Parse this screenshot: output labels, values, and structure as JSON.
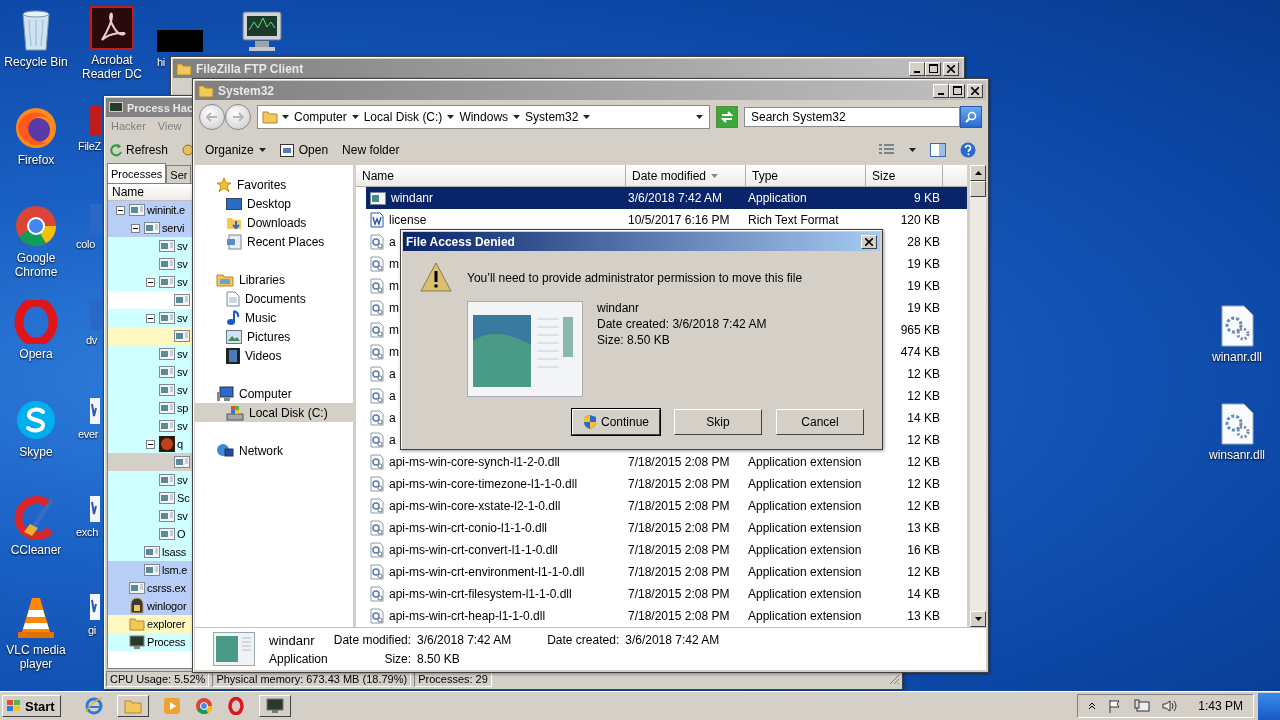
{
  "desktop_icons": [
    {
      "kind": "recycle",
      "label": "Recycle Bin"
    },
    {
      "kind": "pdf",
      "label": "Acrobat Reader DC"
    },
    {
      "kind": "black",
      "label": "hi"
    },
    {
      "kind": "monitor"
    },
    {
      "kind": "firefox",
      "label": "Firefox"
    },
    {
      "kind": "filezilla",
      "label": "FileZ"
    },
    {
      "kind": "chrome",
      "label": "Google Chrome"
    },
    {
      "kind": "doc",
      "label": "colo"
    },
    {
      "kind": "opera",
      "label": "Opera"
    },
    {
      "kind": "doc",
      "label": "dv"
    },
    {
      "kind": "skype",
      "label": "Skype"
    },
    {
      "kind": "word",
      "label": "ever"
    },
    {
      "kind": "ccleaner",
      "label": "CCleaner"
    },
    {
      "kind": "word",
      "label": "exch"
    },
    {
      "kind": "vlc",
      "label": "VLC media player"
    },
    {
      "kind": "word",
      "label": "gi"
    },
    {
      "kind": "dll",
      "label": "winanr.dll"
    },
    {
      "kind": "dll",
      "label": "winsanr.dll"
    }
  ],
  "filezilla": {
    "title": "FileZilla FTP Client"
  },
  "process_hacker": {
    "title": "Process Hac",
    "menu": [
      "Hacker",
      "View"
    ],
    "toolbar": [
      "Refresh"
    ],
    "tabs": [
      {
        "label": "Processes",
        "selected": true
      },
      {
        "label": "Ser",
        "selected": false
      }
    ],
    "column": "Name",
    "processes": [
      {
        "name": "wininit.e",
        "kind": "exe",
        "color": "#b8cef6",
        "expanded": true,
        "children": [
          {
            "name": "servi",
            "kind": "exe",
            "color": "#b8cef6",
            "expanded": true,
            "children": [
              {
                "name": "sv",
                "kind": "exe",
                "color": "#d0ffff"
              },
              {
                "name": "sv",
                "kind": "exe",
                "color": "#d0ffff"
              },
              {
                "name": "sv",
                "kind": "exe",
                "color": "#d0ffff",
                "expanded": true,
                "children": [
                  {
                    "kind": "exe",
                    "color": "#ffffff"
                  }
                ]
              },
              {
                "name": "sv",
                "kind": "exe",
                "color": "#d0ffff",
                "expanded": true,
                "children": [
                  {
                    "kind": "exe",
                    "color": "#fff8c0"
                  }
                ]
              },
              {
                "name": "sv",
                "kind": "exe",
                "color": "#d0ffff"
              },
              {
                "name": "sv",
                "kind": "exe",
                "color": "#d0ffff"
              },
              {
                "name": "sv",
                "kind": "exe",
                "color": "#d0ffff"
              },
              {
                "name": "sp",
                "kind": "exe",
                "color": "#d0ffff"
              },
              {
                "name": "sv",
                "kind": "exe",
                "color": "#d0ffff"
              },
              {
                "name": "q",
                "kind": "game",
                "color": "#d0ffff",
                "expanded": true,
                "children": [
                  {
                    "kind": "exe",
                    "color": "#d4d0c8"
                  }
                ]
              },
              {
                "name": "sv",
                "kind": "exe",
                "color": "#d0ffff"
              },
              {
                "name": "Sc",
                "kind": "exe",
                "color": "#d0ffff"
              },
              {
                "name": "sv",
                "kind": "exe",
                "color": "#d0ffff"
              },
              {
                "name": "O",
                "kind": "exe",
                "color": "#d0ffff"
              }
            ]
          },
          {
            "name": "lsass",
            "kind": "exe",
            "color": "#d0ffff"
          },
          {
            "name": "lsm.e",
            "kind": "exe",
            "color": "#b8cef6"
          }
        ]
      },
      {
        "name": "csrss.ex",
        "kind": "exe",
        "color": "#b8cef6"
      },
      {
        "name": "winlogor",
        "kind": "winlogon",
        "color": "#b8cef6"
      },
      {
        "name": "explorer",
        "kind": "folder",
        "color": "#fff8c0"
      },
      {
        "name": "Process",
        "kind": "hacker",
        "color": "#d0ffff"
      }
    ],
    "status": [
      "CPU Usage: 5.52%",
      "Physical memory: 673.43 MB (18.79%)",
      "Processes: 29"
    ]
  },
  "explorer": {
    "title": "System32",
    "breadcrumb": [
      "Computer",
      "Local Disk (C:)",
      "Windows",
      "System32"
    ],
    "search": {
      "placeholder": "Search System32"
    },
    "toolbar": [
      "Organize",
      "Open",
      "New folder"
    ],
    "nav": [
      {
        "label": "Favorites",
        "kind": "favorites",
        "selected": false,
        "children": [
          {
            "label": "Desktop",
            "kind": "desktop",
            "selected": false
          },
          {
            "label": "Downloads",
            "kind": "downloads",
            "selected": false
          },
          {
            "label": "Recent Places",
            "kind": "recent",
            "selected": false
          }
        ]
      },
      {
        "label": "Libraries",
        "kind": "libraries",
        "selected": false,
        "children": [
          {
            "label": "Documents",
            "kind": "documents",
            "selected": false
          },
          {
            "label": "Music",
            "kind": "music",
            "selected": false
          },
          {
            "label": "Pictures",
            "kind": "pictures",
            "selected": false
          },
          {
            "label": "Videos",
            "kind": "videos",
            "selected": false
          }
        ]
      },
      {
        "label": "Computer",
        "kind": "computer",
        "selected": false,
        "children": [
          {
            "label": "Local Disk (C:)",
            "kind": "disk",
            "selected": true
          }
        ]
      },
      {
        "label": "Network",
        "kind": "network",
        "selected": false
      }
    ],
    "columns": [
      {
        "label": "Name",
        "sorted": false
      },
      {
        "label": "Date modified",
        "sorted": true
      },
      {
        "label": "Type",
        "sorted": false
      },
      {
        "label": "Size",
        "sorted": false
      }
    ],
    "files": [
      {
        "name": "windanr",
        "date": "3/6/2018 7:42 AM",
        "type": "Application",
        "size": "9 KB",
        "kind": "app",
        "selected": true
      },
      {
        "name": "license",
        "date": "10/5/2017 6:16 PM",
        "type": "Rich Text Format",
        "size": "120 KB",
        "kind": "rtf",
        "selected": false
      },
      {
        "name": "a",
        "size": "28 KB",
        "kind": "dll",
        "selected": false
      },
      {
        "name": "m",
        "size": "19 KB",
        "kind": "dll",
        "selected": false
      },
      {
        "name": "m",
        "size": "19 KB",
        "kind": "dll",
        "selected": false
      },
      {
        "name": "m",
        "size": "19 KB",
        "kind": "dll",
        "selected": false
      },
      {
        "name": "m",
        "size": "965 KB",
        "kind": "dll",
        "selected": false
      },
      {
        "name": "m",
        "size": "474 KB",
        "kind": "dll",
        "selected": false
      },
      {
        "name": "a",
        "size": "12 KB",
        "kind": "dll",
        "selected": false
      },
      {
        "name": "a",
        "size": "12 KB",
        "kind": "dll",
        "selected": false
      },
      {
        "name": "a",
        "size": "14 KB",
        "kind": "dll",
        "selected": false
      },
      {
        "name": "a",
        "size": "12 KB",
        "kind": "dll",
        "selected": false
      },
      {
        "name": "api-ms-win-core-synch-l1-2-0.dll",
        "date": "7/18/2015 2:08 PM",
        "type": "Application extension",
        "size": "12 KB",
        "kind": "dll",
        "selected": false
      },
      {
        "name": "api-ms-win-core-timezone-l1-1-0.dll",
        "date": "7/18/2015 2:08 PM",
        "type": "Application extension",
        "size": "12 KB",
        "kind": "dll",
        "selected": false
      },
      {
        "name": "api-ms-win-core-xstate-l2-1-0.dll",
        "date": "7/18/2015 2:08 PM",
        "type": "Application extension",
        "size": "12 KB",
        "kind": "dll",
        "selected": false
      },
      {
        "name": "api-ms-win-crt-conio-l1-1-0.dll",
        "date": "7/18/2015 2:08 PM",
        "type": "Application extension",
        "size": "13 KB",
        "kind": "dll",
        "selected": false
      },
      {
        "name": "api-ms-win-crt-convert-l1-1-0.dll",
        "date": "7/18/2015 2:08 PM",
        "type": "Application extension",
        "size": "16 KB",
        "kind": "dll",
        "selected": false
      },
      {
        "name": "api-ms-win-crt-environment-l1-1-0.dll",
        "date": "7/18/2015 2:08 PM",
        "type": "Application extension",
        "size": "12 KB",
        "kind": "dll",
        "selected": false
      },
      {
        "name": "api-ms-win-crt-filesystem-l1-1-0.dll",
        "date": "7/18/2015 2:08 PM",
        "type": "Application extension",
        "size": "14 KB",
        "kind": "dll",
        "selected": false
      },
      {
        "name": "api-ms-win-crt-heap-l1-1-0.dll",
        "date": "7/18/2015 2:08 PM",
        "type": "Application extension",
        "size": "13 KB",
        "kind": "dll",
        "selected": false
      }
    ],
    "details": {
      "name": "windanr",
      "type": "Application",
      "fields": [
        {
          "label": "Date modified:",
          "value": "3/6/2018 7:42 AM"
        },
        {
          "label": "Date created:",
          "value": "3/6/2018 7:42 AM"
        },
        {
          "label": "Size:",
          "value": "8.50 KB"
        }
      ]
    }
  },
  "dialog": {
    "title": "File Access Denied",
    "message": "You’ll need to provide administrator permission to move this file",
    "file_name": "windanr",
    "file_info": [
      "Date created: 3/6/2018 7:42 AM",
      "Size: 8.50 KB"
    ],
    "buttons": [
      {
        "label": "Continue",
        "kind": "shield",
        "default": true
      },
      {
        "label": "Skip",
        "kind": "plain",
        "default": false
      },
      {
        "label": "Cancel",
        "kind": "plain",
        "default": false
      }
    ]
  },
  "taskbar": {
    "start": "Start",
    "clock": "1:43 PM"
  }
}
